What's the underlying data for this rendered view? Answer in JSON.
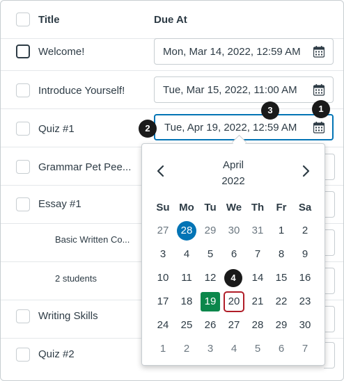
{
  "header": {
    "title_label": "Title",
    "due_label": "Due At"
  },
  "rows": [
    {
      "title": "Welcome!",
      "due": "Mon, Mar 14, 2022, 12:59 AM"
    },
    {
      "title": "Introduce Yourself!",
      "due": "Tue, Mar 15, 2022, 11:00 AM"
    },
    {
      "title": "Quiz #1",
      "due": "Tue, Apr 19, 2022, 12:59 AM"
    },
    {
      "title": "Grammar Pet Pee..."
    },
    {
      "title": "Essay #1"
    },
    {
      "title": "Basic Written Co..."
    },
    {
      "title": "2 students"
    },
    {
      "title": "Writing Skills"
    },
    {
      "title": "Quiz #2"
    }
  ],
  "calendar": {
    "month": "April",
    "year": "2022",
    "weekdays": [
      "Su",
      "Mo",
      "Tu",
      "We",
      "Th",
      "Fr",
      "Sa"
    ],
    "weeks": [
      [
        "27",
        "28",
        "29",
        "30",
        "31",
        "1",
        "2"
      ],
      [
        "3",
        "4",
        "5",
        "6",
        "7",
        "8",
        "9"
      ],
      [
        "10",
        "11",
        "12",
        "13",
        "14",
        "15",
        "16"
      ],
      [
        "17",
        "18",
        "19",
        "20",
        "21",
        "22",
        "23"
      ],
      [
        "24",
        "25",
        "26",
        "27",
        "28",
        "29",
        "30"
      ],
      [
        "1",
        "2",
        "3",
        "4",
        "5",
        "6",
        "7"
      ]
    ],
    "today": "28",
    "selected": "19",
    "focused": "20",
    "colors": {
      "today": "#0374b5",
      "selected": "#0b874b",
      "focused": "#b01d28",
      "accent": "#0374b5"
    }
  },
  "markers": [
    "1",
    "2",
    "3",
    "4"
  ]
}
